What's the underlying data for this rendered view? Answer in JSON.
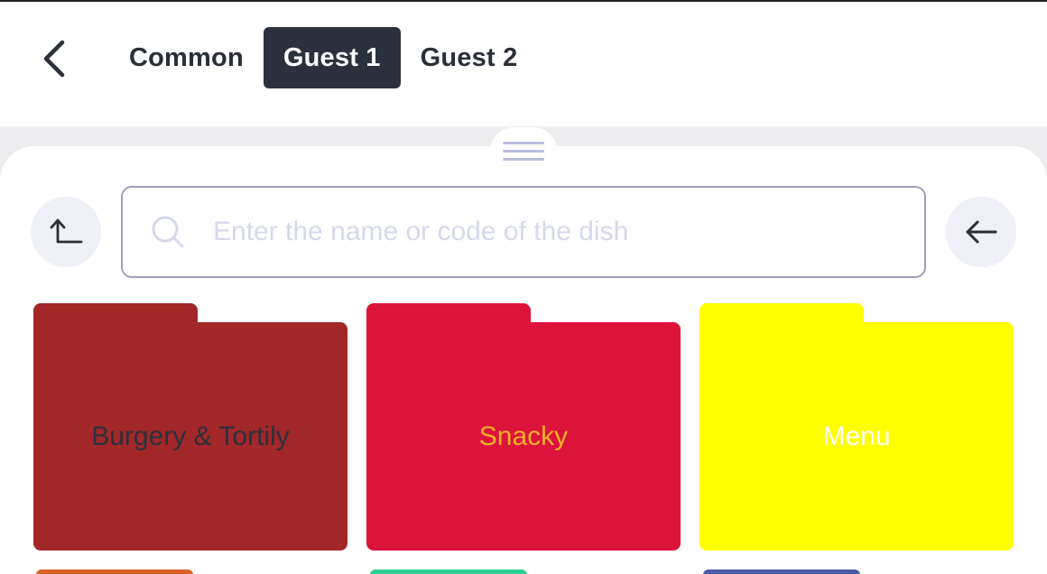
{
  "header": {
    "back_icon": "chevron-left-icon",
    "tabs": [
      {
        "label": "Common",
        "active": false
      },
      {
        "label": "Guest 1",
        "active": true
      },
      {
        "label": "Guest 2",
        "active": false
      }
    ]
  },
  "toolbar": {
    "up_icon": "arrow-up-level-icon",
    "back_arrow_icon": "arrow-left-icon",
    "search": {
      "placeholder": "Enter the name or code of the dish",
      "value": ""
    }
  },
  "folders": [
    {
      "label": "Burgery & Tortily",
      "color": "#a12728",
      "text_color": "#2b313c"
    },
    {
      "label": "Snacky",
      "color": "#dc143c",
      "text_color": "#f2b027"
    },
    {
      "label": "Menu",
      "color": "#ffff00",
      "text_color": "#ffffff"
    }
  ],
  "partial_folders": [
    {
      "color": "#d9622b"
    },
    {
      "color": "#2ecf94"
    },
    {
      "color": "#4a5aa8"
    }
  ]
}
